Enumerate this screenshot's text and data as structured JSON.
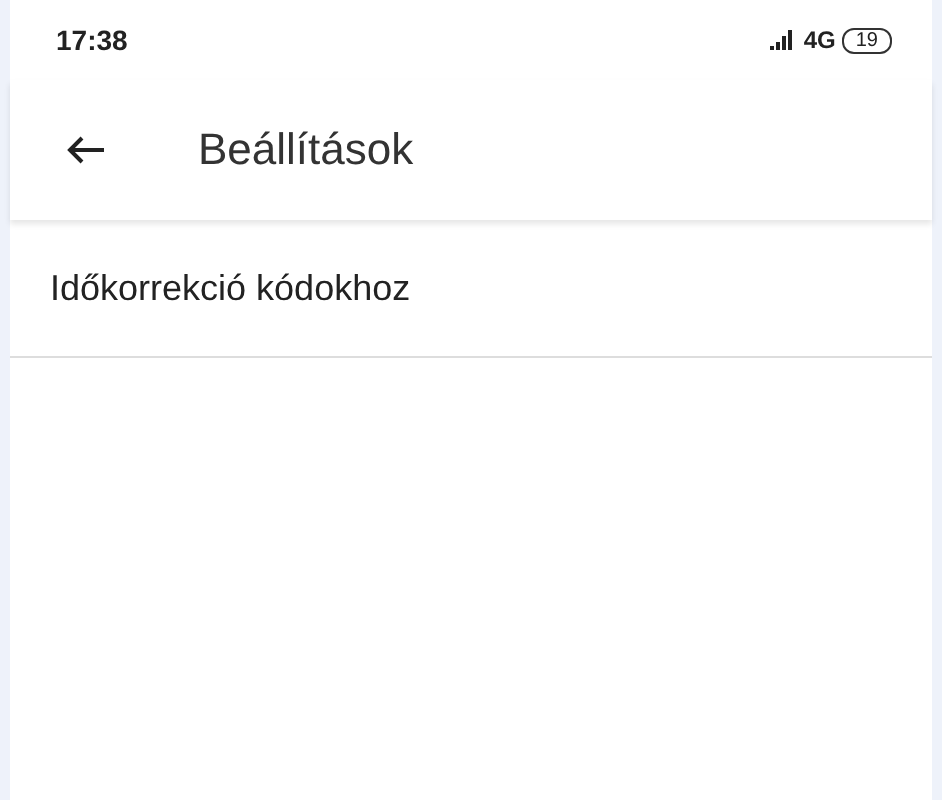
{
  "status_bar": {
    "time": "17:38",
    "network": "4G",
    "battery": "19"
  },
  "app_bar": {
    "title": "Beállítások"
  },
  "settings": [
    {
      "label": "Időkorrekció kódokhoz"
    }
  ]
}
